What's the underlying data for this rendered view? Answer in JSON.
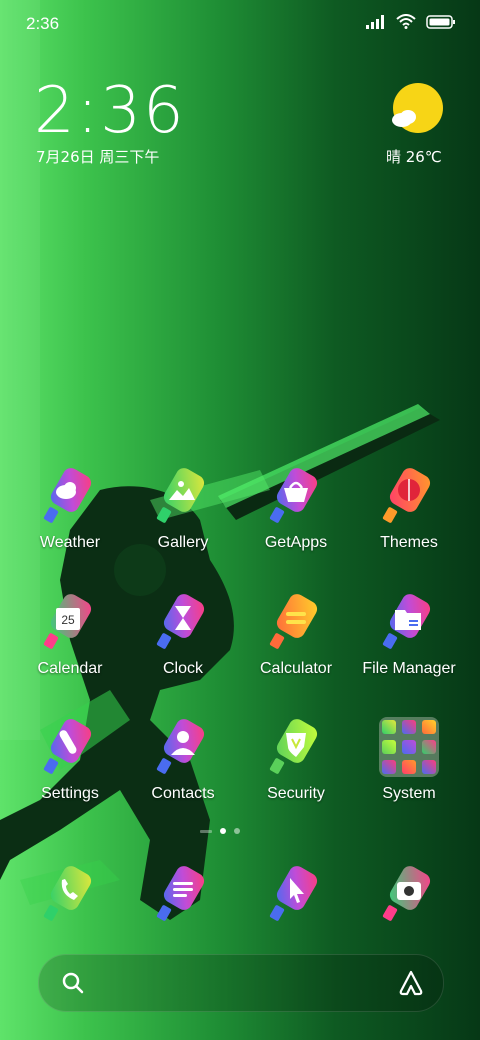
{
  "status_bar": {
    "time": "2:36",
    "icons": [
      "signal-icon",
      "wifi-icon",
      "battery-icon"
    ]
  },
  "clock_widget": {
    "time": "2:36",
    "date": "7月26日 周三下午"
  },
  "weather_widget": {
    "condition_temp": "晴 26℃",
    "icon": "sun-cloud-icon"
  },
  "apps": [
    {
      "label": "Weather",
      "icon": "weather-icon"
    },
    {
      "label": "Gallery",
      "icon": "gallery-icon"
    },
    {
      "label": "GetApps",
      "icon": "getapps-icon"
    },
    {
      "label": "Themes",
      "icon": "themes-icon"
    },
    {
      "label": "Calendar",
      "icon": "calendar-icon",
      "badge": "25"
    },
    {
      "label": "Clock",
      "icon": "clock-icon"
    },
    {
      "label": "Calculator",
      "icon": "calculator-icon"
    },
    {
      "label": "File Manager",
      "icon": "file-manager-icon"
    },
    {
      "label": "Settings",
      "icon": "settings-icon"
    },
    {
      "label": "Contacts",
      "icon": "contacts-icon"
    },
    {
      "label": "Security",
      "icon": "security-icon"
    },
    {
      "label": "System",
      "icon": "folder-icon"
    }
  ],
  "dock": [
    {
      "icon": "phone-icon"
    },
    {
      "icon": "messages-icon"
    },
    {
      "icon": "browser-icon"
    },
    {
      "icon": "camera-icon"
    }
  ],
  "page_indicator": {
    "pages": 2,
    "active": 0
  },
  "search_bar": {
    "left_icon": "search-icon",
    "right_icon": "assistant-icon"
  },
  "colors": {
    "accent_green": "#3cc24c",
    "sun_yellow": "#f7d516"
  }
}
